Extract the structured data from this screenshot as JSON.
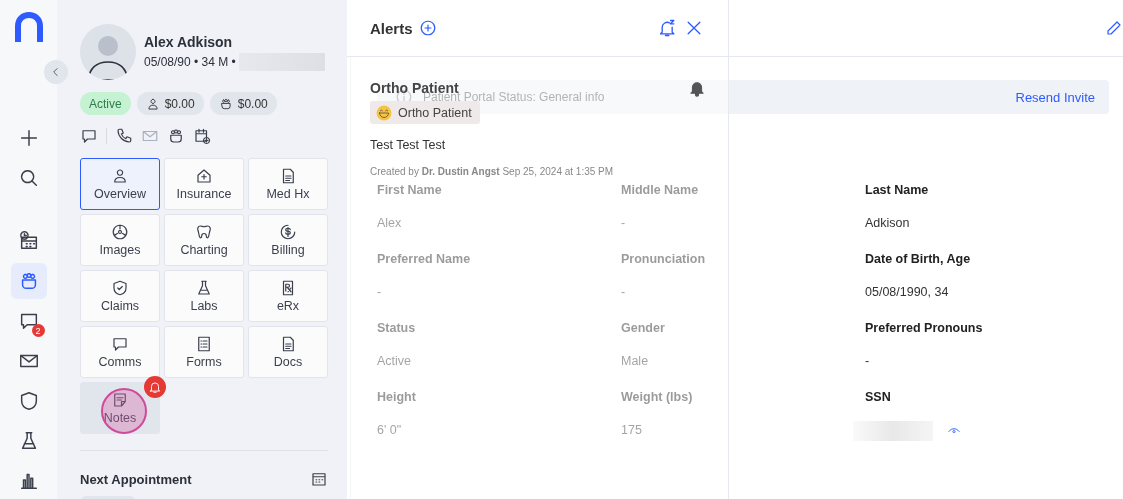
{
  "rail": {
    "groups": [
      [
        {
          "kind": "plus",
          "selected": false
        },
        {
          "kind": "search",
          "selected": false
        }
      ],
      [
        {
          "kind": "calendar-clock",
          "selected": false
        },
        {
          "kind": "patients",
          "selected": true
        },
        {
          "kind": "chat",
          "selected": false,
          "badge": "2"
        },
        {
          "kind": "mail",
          "selected": false
        },
        {
          "kind": "shield",
          "selected": false
        },
        {
          "kind": "flask",
          "selected": false
        },
        {
          "kind": "bar-chart",
          "selected": false
        }
      ]
    ]
  },
  "patient": {
    "name": "Alex Adkison",
    "info": "05/08/90 • 34 M •",
    "status": "Active",
    "balances": [
      {
        "kind": "person",
        "amount": "$0.00"
      },
      {
        "kind": "patients",
        "amount": "$0.00"
      }
    ],
    "actions": [
      {
        "kind": "chat",
        "disabled": false
      },
      {
        "kind": "phone",
        "disabled": false
      },
      {
        "kind": "mail",
        "disabled": true
      },
      {
        "kind": "patients",
        "disabled": false
      },
      {
        "kind": "calendar-add",
        "disabled": false
      }
    ]
  },
  "tiles": [
    {
      "label": "Overview",
      "kind": "person",
      "selected": true,
      "pressed": false,
      "alert": false
    },
    {
      "label": "Insurance",
      "kind": "house-plus",
      "selected": false,
      "pressed": false,
      "alert": false
    },
    {
      "label": "Med Hx",
      "kind": "document",
      "selected": false,
      "pressed": false,
      "alert": false
    },
    {
      "label": "Images",
      "kind": "radiation",
      "selected": false,
      "pressed": false,
      "alert": false
    },
    {
      "label": "Charting",
      "kind": "tooth",
      "selected": false,
      "pressed": false,
      "alert": false
    },
    {
      "label": "Billing",
      "kind": "dollar-cycle",
      "selected": false,
      "pressed": false,
      "alert": false
    },
    {
      "label": "Claims",
      "kind": "shield-check",
      "selected": false,
      "pressed": false,
      "alert": false
    },
    {
      "label": "Labs",
      "kind": "flask",
      "selected": false,
      "pressed": false,
      "alert": false
    },
    {
      "label": "eRx",
      "kind": "rx",
      "selected": false,
      "pressed": false,
      "alert": false
    },
    {
      "label": "Comms",
      "kind": "chat",
      "selected": false,
      "pressed": false,
      "alert": false
    },
    {
      "label": "Forms",
      "kind": "form",
      "selected": false,
      "pressed": false,
      "alert": false
    },
    {
      "label": "Docs",
      "kind": "document",
      "selected": false,
      "pressed": false,
      "alert": false
    },
    {
      "label": "Notes",
      "kind": "note",
      "selected": false,
      "pressed": true,
      "alert": true
    }
  ],
  "next_appointment": {
    "title": "Next Appointment"
  },
  "overview": {
    "banner": {
      "text": "Patient Portal Status: General info",
      "action": "Resend Invite"
    },
    "fields": [
      {
        "label": "First Name",
        "value": "Alex",
        "masked": false
      },
      {
        "label": "Middle Name",
        "value": "-",
        "masked": false
      },
      {
        "label": "Last Name",
        "value": "Adkison",
        "masked": false
      },
      {
        "label": "Preferred Name",
        "value": "-",
        "masked": false
      },
      {
        "label": "Pronunciation",
        "value": "-",
        "masked": false
      },
      {
        "label": "Date of Birth, Age",
        "value": "05/08/1990, 34",
        "masked": false
      },
      {
        "label": "Status",
        "value": "Active",
        "masked": false
      },
      {
        "label": "Gender",
        "value": "Male",
        "masked": false
      },
      {
        "label": "Preferred Pronouns",
        "value": "-",
        "masked": false
      },
      {
        "label": "Height",
        "value": "6' 0\"",
        "masked": false
      },
      {
        "label": "Weight (lbs)",
        "value": "175",
        "masked": false
      },
      {
        "label": "SSN",
        "masked": true
      }
    ]
  },
  "alerts": {
    "title": "Alerts",
    "items": [
      {
        "heading": "Ortho Patient",
        "tag": "Ortho Patient",
        "note": "Test Test Test",
        "created": "Created by **Dr. Dustin Angst** Sep 25, 2024 at 1:35 PM"
      }
    ]
  }
}
